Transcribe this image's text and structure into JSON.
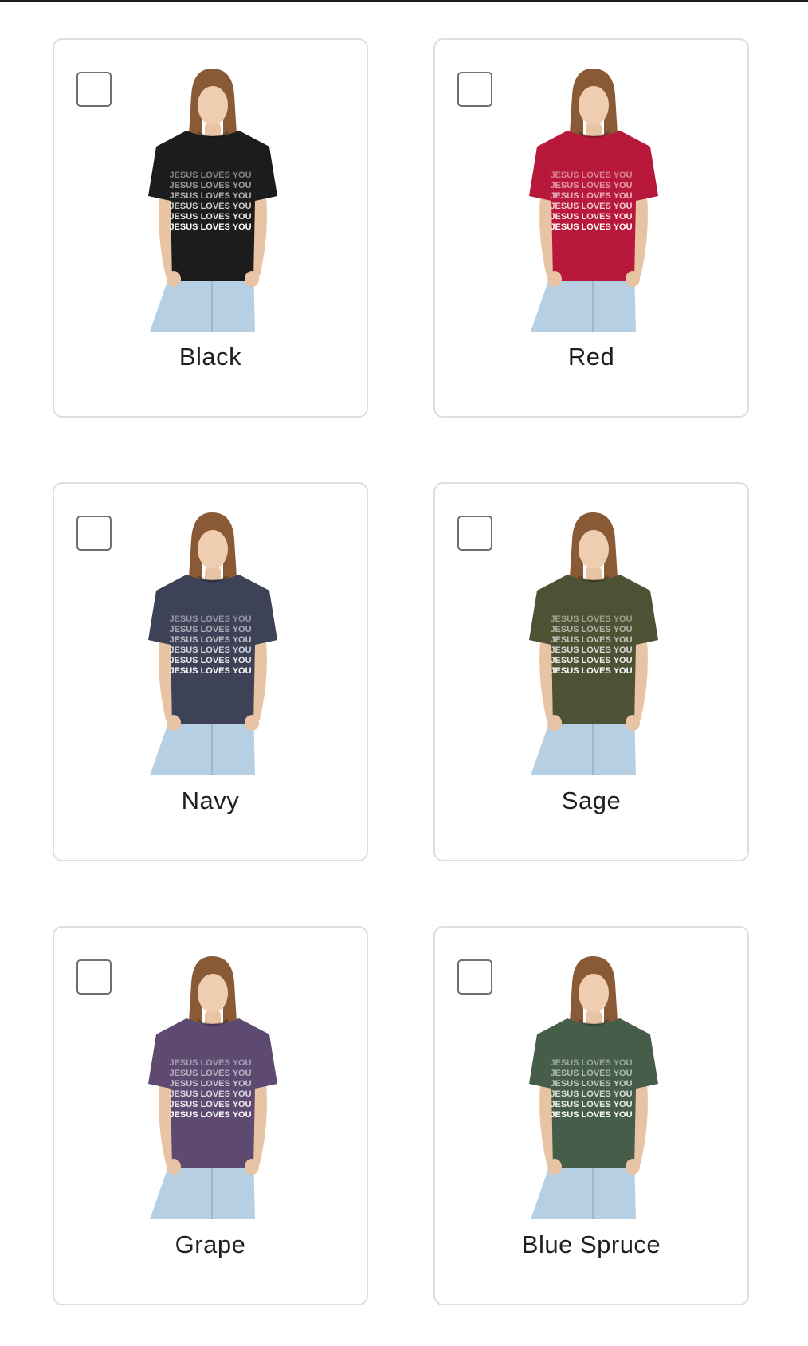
{
  "colors": {
    "accent_border": "#dedede",
    "checkbox_border": "#6f6f6f",
    "text": "#1f1f1f"
  },
  "shirt_print_text": "JESUS LOVES YOU",
  "options": [
    {
      "label": "Black",
      "checked": false,
      "shirt_color": "#1c1c1c"
    },
    {
      "label": "Red",
      "checked": false,
      "shirt_color": "#b8193a"
    },
    {
      "label": "Navy",
      "checked": false,
      "shirt_color": "#3d4257"
    },
    {
      "label": "Sage",
      "checked": false,
      "shirt_color": "#4d5234"
    },
    {
      "label": "Grape",
      "checked": false,
      "shirt_color": "#5e4a70"
    },
    {
      "label": "Blue Spruce",
      "checked": false,
      "shirt_color": "#465e49"
    }
  ]
}
